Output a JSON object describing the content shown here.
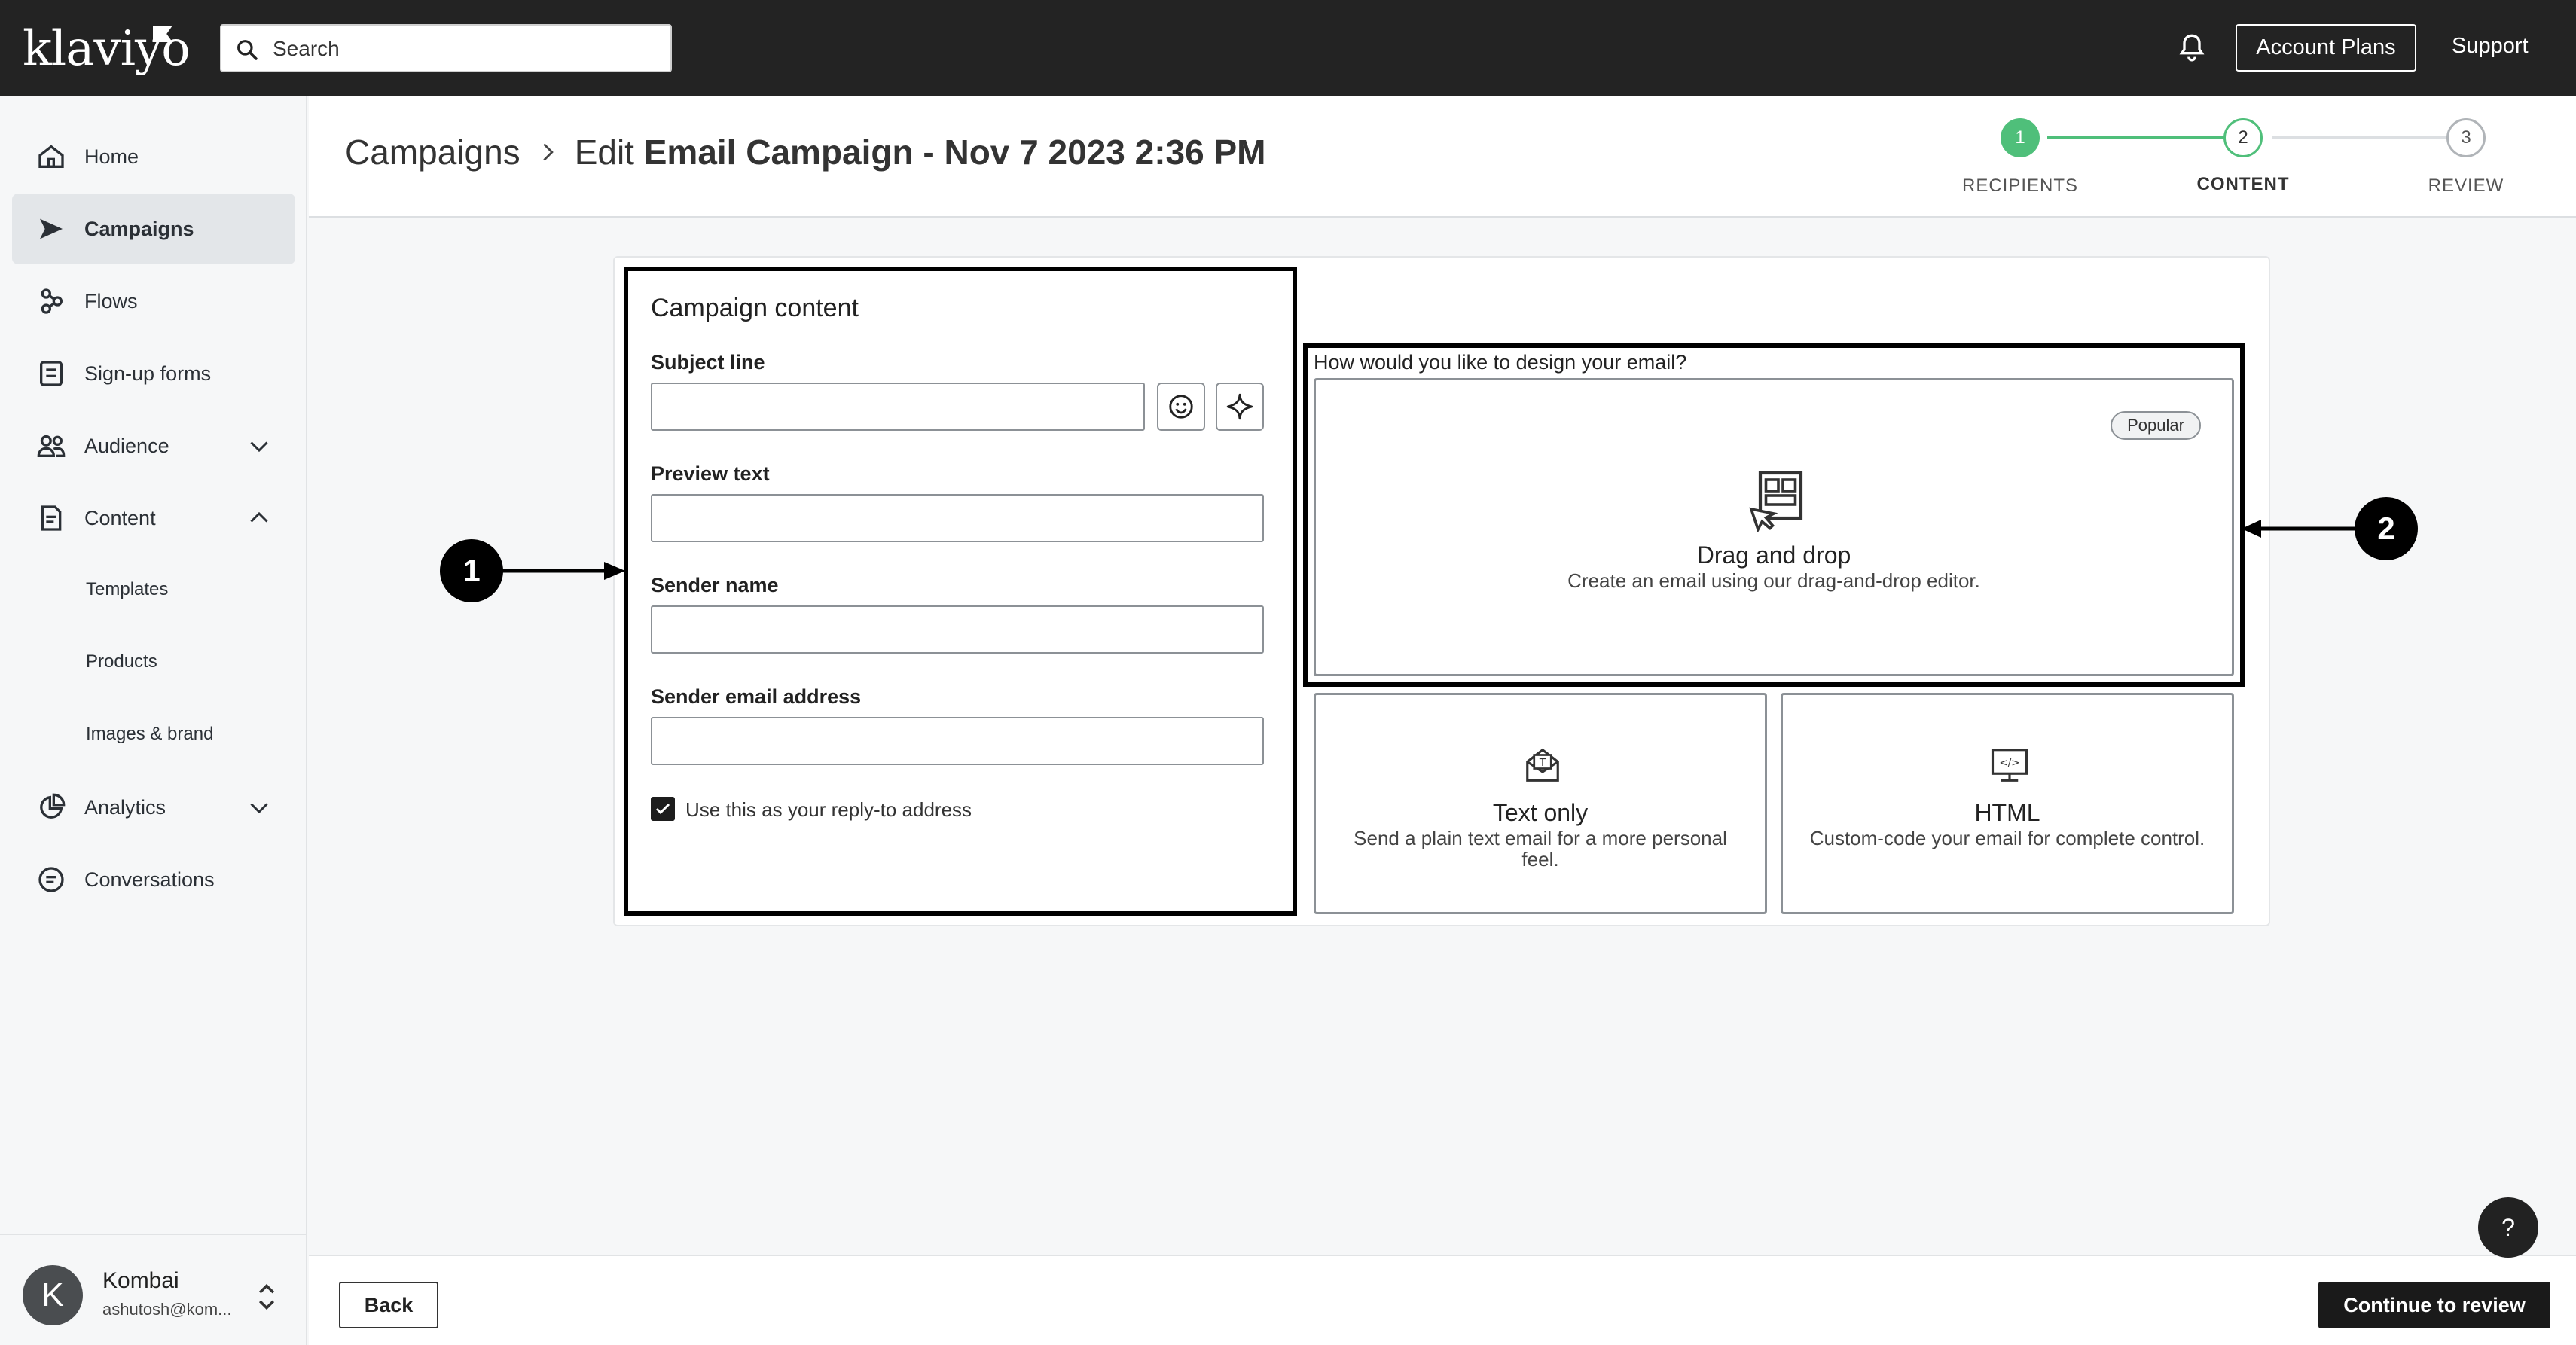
{
  "app": {
    "logo": "klaviyo"
  },
  "topbar": {
    "search_placeholder": "Search",
    "account_plans": "Account Plans",
    "support": "Support"
  },
  "sidebar": {
    "items": [
      {
        "label": "Home"
      },
      {
        "label": "Campaigns"
      },
      {
        "label": "Flows"
      },
      {
        "label": "Sign-up forms"
      },
      {
        "label": "Audience"
      },
      {
        "label": "Content"
      },
      {
        "label": "Analytics"
      },
      {
        "label": "Conversations"
      }
    ],
    "content_sub": [
      "Templates",
      "Products",
      "Images & brand"
    ],
    "user": {
      "initial": "K",
      "name": "Kombai",
      "email": "ashutosh@kom..."
    }
  },
  "header": {
    "breadcrumb_root": "Campaigns",
    "title_prefix": "Edit",
    "title": "Email Campaign - Nov 7 2023 2:36 PM",
    "steps": [
      {
        "num": "1",
        "label": "RECIPIENTS"
      },
      {
        "num": "2",
        "label": "CONTENT"
      },
      {
        "num": "3",
        "label": "REVIEW"
      }
    ],
    "active_color": "#4fbf7a"
  },
  "form": {
    "title": "Campaign content",
    "subject_label": "Subject line",
    "preview_label": "Preview text",
    "sender_name_label": "Sender name",
    "sender_email_label": "Sender email address",
    "reply_to_label": "Use this as your reply-to address"
  },
  "design": {
    "question": "How would you like to design your email?",
    "options": [
      {
        "title": "Drag and drop",
        "desc": "Create an email using our drag-and-drop editor.",
        "badge": "Popular"
      },
      {
        "title": "Text only",
        "desc": "Send a plain text email for a more personal feel."
      },
      {
        "title": "HTML",
        "desc": "Custom-code your email for complete control."
      }
    ]
  },
  "markers": [
    "1",
    "2"
  ],
  "footer": {
    "back": "Back",
    "continue": "Continue to review"
  },
  "help": "?"
}
